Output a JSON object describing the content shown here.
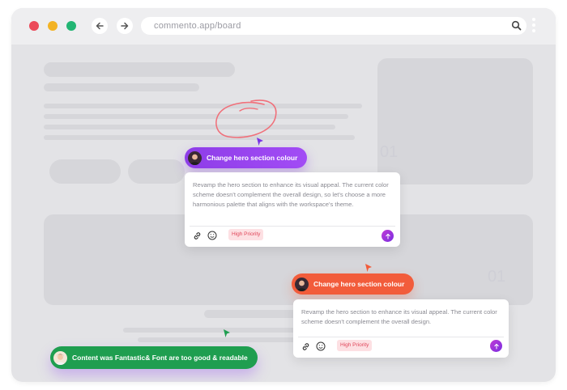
{
  "browser": {
    "url": "commento.app/board"
  },
  "board": {
    "big_number_1": "01",
    "big_number_2": "01"
  },
  "comments": [
    {
      "title": "Change hero section colour",
      "body": "Revamp the hero section to enhance its visual appeal. The current color scheme doesn't complement the overall design, so let's choose a more harmonious palette that aligns with the workspace's theme.",
      "tag": "High Priority",
      "accent": "#9a44f0"
    },
    {
      "title": "Change hero section colour",
      "body": "Revamp the hero section to enhance its visual appeal. The current color scheme doesn't complement the overall design.",
      "tag": "High Priority",
      "accent": "#f25c3b"
    },
    {
      "title": "Content was Fantastic& Font are too good & readable",
      "accent": "#1f9e50"
    }
  ],
  "colors": {
    "window_bg": "#e3e3e6",
    "placeholder": "#d6d6da",
    "tag_bg": "#fde0e3",
    "tag_text": "#e0465a",
    "scribble": "#f0707a"
  },
  "icons": [
    "back-arrow-icon",
    "forward-arrow-icon",
    "search-icon",
    "kebab-menu-icon",
    "link-icon",
    "smiley-icon",
    "send-arrow-icon",
    "cursor-icon"
  ]
}
